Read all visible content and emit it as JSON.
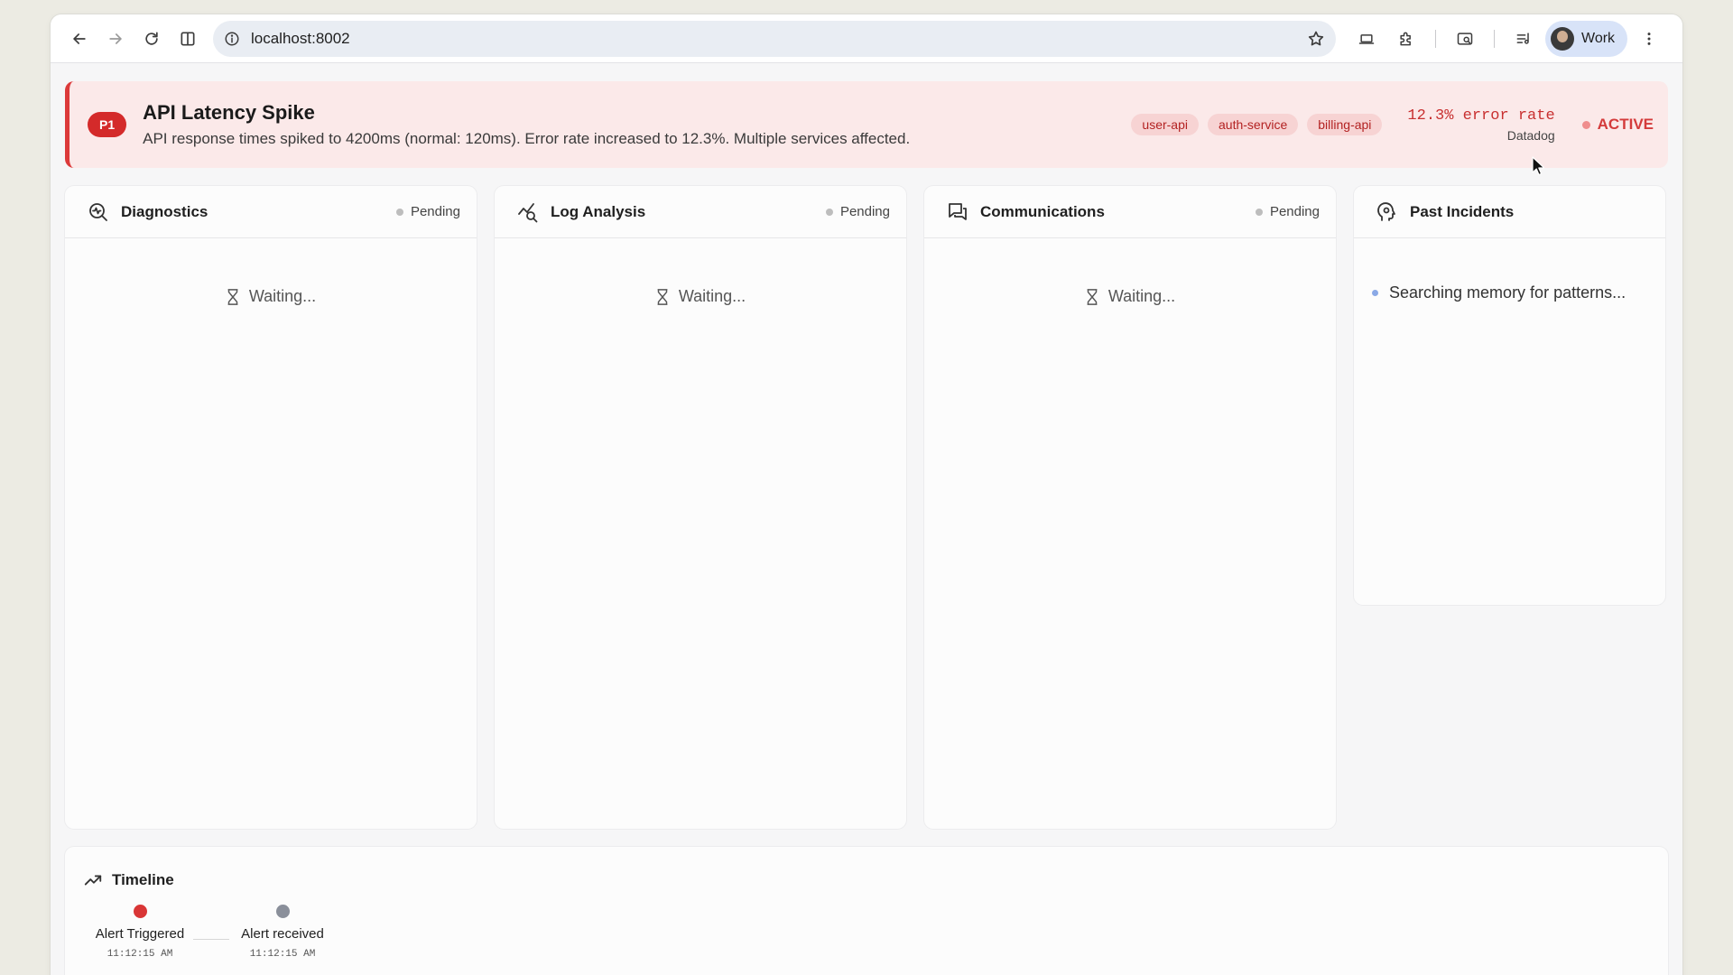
{
  "browser": {
    "url": "localhost:8002",
    "profile_label": "Work"
  },
  "incident": {
    "priority": "P1",
    "title": "API Latency Spike",
    "description": "API response times spiked to 4200ms (normal: 120ms). Error rate increased to 12.3%. Multiple services affected.",
    "services": [
      "user-api",
      "auth-service",
      "billing-api"
    ],
    "error_rate": "12.3% error rate",
    "source": "Datadog",
    "status": "ACTIVE"
  },
  "panels": [
    {
      "title": "Diagnostics",
      "status": "Pending",
      "body": "Waiting..."
    },
    {
      "title": "Log Analysis",
      "status": "Pending",
      "body": "Waiting..."
    },
    {
      "title": "Communications",
      "status": "Pending",
      "body": "Waiting..."
    },
    {
      "title": "Past Incidents",
      "body": "Searching memory for patterns..."
    }
  ],
  "timeline": {
    "title": "Timeline",
    "events": [
      {
        "label": "Alert Triggered",
        "time": "11:12:15 AM",
        "color": "#d93636"
      },
      {
        "label": "Alert received",
        "time": "11:12:15 AM",
        "color": "#8a8f9a"
      }
    ]
  }
}
